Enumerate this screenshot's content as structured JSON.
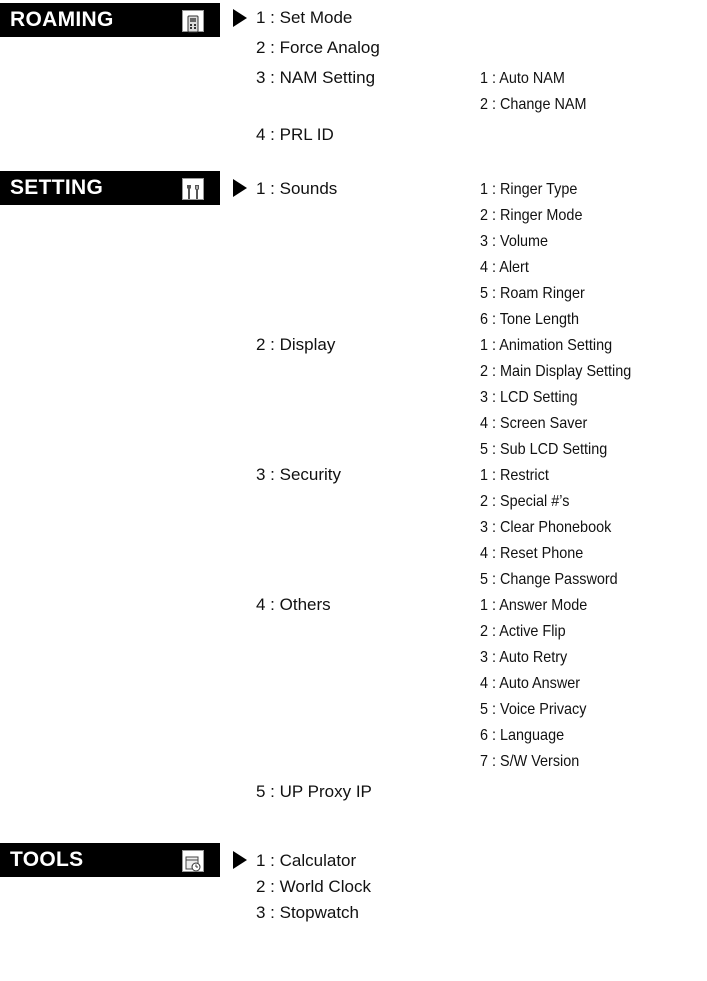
{
  "sections": {
    "roaming": {
      "title": "ROAMING",
      "icon": "phone-card-icon",
      "items": [
        {
          "label": "1 : Set Mode"
        },
        {
          "label": "2 : Force Analog"
        },
        {
          "label": "3 : NAM Setting",
          "sub": [
            "1 : Auto NAM",
            "2 : Change NAM"
          ]
        },
        {
          "label": "4 : PRL ID"
        }
      ]
    },
    "setting": {
      "title": "SETTING",
      "icon": "tools-settings-icon",
      "items": [
        {
          "label": "1 : Sounds",
          "sub": [
            "1 : Ringer Type",
            "2 : Ringer Mode",
            "3 : Volume",
            "4 : Alert",
            "5 : Roam Ringer",
            "6 : Tone Length"
          ]
        },
        {
          "label": "2 : Display",
          "sub": [
            "1 : Animation Setting",
            "2 : Main Display Setting",
            "3 : LCD Setting",
            "4 : Screen Saver",
            "5 : Sub LCD Setting"
          ]
        },
        {
          "label": "3 : Security",
          "sub": [
            "1 : Restrict",
            "2 : Special #’s",
            "3 : Clear Phonebook",
            "4 : Reset Phone",
            "5 : Change Password"
          ]
        },
        {
          "label": "4 : Others",
          "sub": [
            "1 : Answer Mode",
            "2 : Active Flip",
            "3 : Auto Retry",
            "4 : Auto Answer",
            "5 : Voice Privacy",
            "6 : Language",
            "7 : S/W Version"
          ]
        },
        {
          "label": "5 : UP Proxy IP"
        }
      ]
    },
    "tools": {
      "title": "TOOLS",
      "icon": "calendar-clock-icon",
      "items": [
        {
          "label": "1 : Calculator"
        },
        {
          "label": "2 : World Clock"
        },
        {
          "label": "3 : Stopwatch"
        }
      ]
    }
  }
}
